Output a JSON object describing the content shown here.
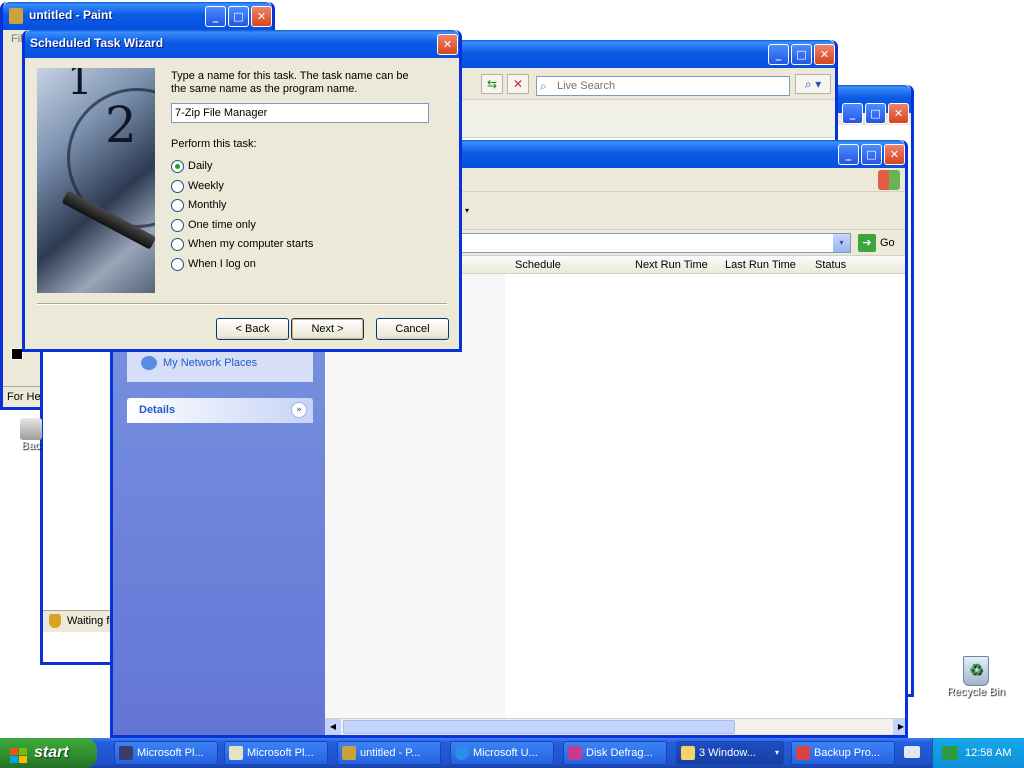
{
  "paint": {
    "title": "untitled - Paint",
    "menu_hint": "File",
    "status": "For Help"
  },
  "explorer_main": {
    "search_placeholder": "Live Search",
    "go_label": "Go",
    "columns": [
      "Schedule",
      "Next Run Time",
      "Last Run Time",
      "Status"
    ],
    "network_places": "My Network Places",
    "details_label": "Details",
    "status_text": "Waiting fo"
  },
  "wizard": {
    "title": "Scheduled Task Wizard",
    "prompt_line1": "Type a name for this task.  The task name can be",
    "prompt_line2": "the same name as the program name.",
    "task_name": "7-Zip File Manager",
    "perform_label": "Perform this task:",
    "options": [
      "Daily",
      "Weekly",
      "Monthly",
      "One time only",
      "When my computer starts",
      "When I log on"
    ],
    "selected_option": "Daily",
    "back_label": "< Back",
    "next_label": "Next >",
    "cancel_label": "Cancel"
  },
  "desktop": {
    "recycle_bin": "Recycle Bin",
    "backup_icon": "Bac"
  },
  "taskbar": {
    "start_label": "start",
    "items": [
      {
        "label": "Microsoft Pl...",
        "icon": "media-player-icon"
      },
      {
        "label": "Microsoft Pl...",
        "icon": "media-player-icon"
      },
      {
        "label": "untitled - P...",
        "icon": "paint-icon"
      },
      {
        "label": "Microsoft U...",
        "icon": "ie-icon"
      },
      {
        "label": "Disk Defrag...",
        "icon": "defrag-icon"
      },
      {
        "label": "3 Window...",
        "icon": "folder-icon"
      },
      {
        "label": "Backup Pro...",
        "icon": "backup-icon"
      }
    ],
    "clock": "12:58 AM"
  },
  "colors": {
    "title_blue": "#0b5be6",
    "xp_taskbar": "#245edb",
    "task_pane": "#7a96df"
  }
}
